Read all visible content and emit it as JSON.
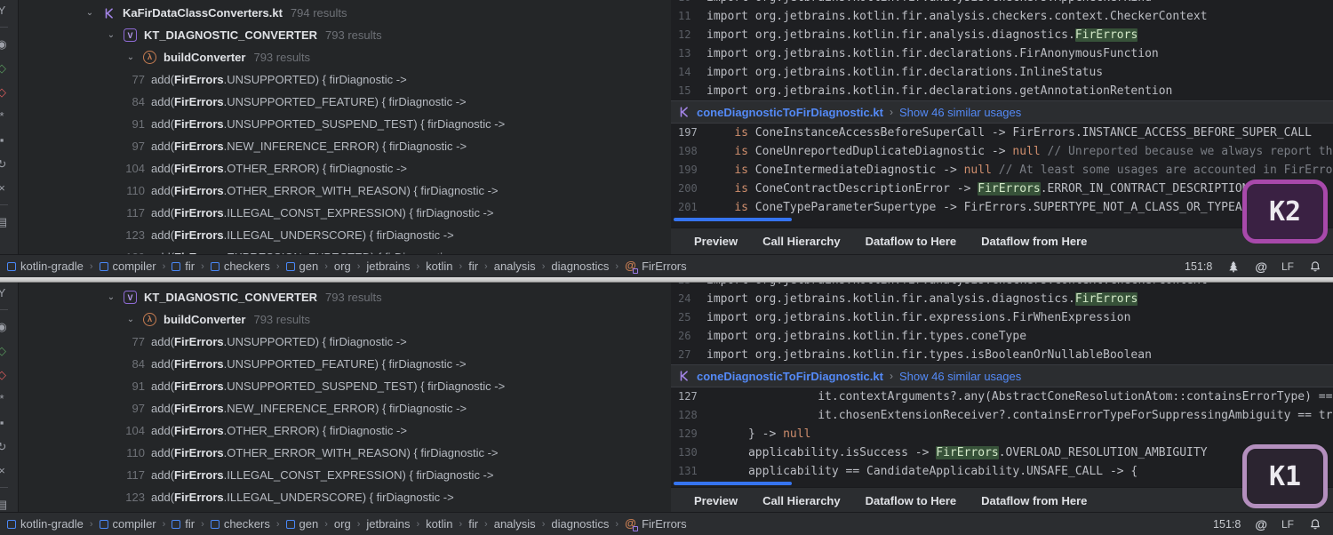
{
  "shared": {
    "tabs": [
      "Preview",
      "Call Hierarchy",
      "Dataflow to Here",
      "Dataflow from Here"
    ],
    "preview_file": "coneDiagnosticToFirDiagnostic.kt",
    "show_similar": "Show 46 similar usages",
    "caret_position": "151:8",
    "line_ending": "LF",
    "breadcrumbs": [
      {
        "label": "kotlin-gradle",
        "icon": "module"
      },
      {
        "label": "compiler",
        "icon": "module"
      },
      {
        "label": "fir",
        "icon": "module"
      },
      {
        "label": "checkers",
        "icon": "module"
      },
      {
        "label": "gen",
        "icon": "module"
      },
      {
        "label": "org"
      },
      {
        "label": "jetbrains"
      },
      {
        "label": "kotlin"
      },
      {
        "label": "fir"
      },
      {
        "label": "analysis"
      },
      {
        "label": "diagnostics"
      },
      {
        "label": "FirErrors",
        "icon": "kotlin-object"
      }
    ],
    "tree": {
      "file_name": "KaFirDataClassConverters.kt",
      "file_count": "794 results",
      "field_name": "KT_DIAGNOSTIC_CONVERTER",
      "field_count": "793 results",
      "function_name": "buildConverter",
      "function_count": "793 results",
      "val_icon_glyph": "V",
      "function_icon_glyph": "λ"
    },
    "usages": [
      {
        "line": "77",
        "call": "add(",
        "match": "FirErrors",
        "rest": ".UNSUPPORTED) { firDiagnostic ->"
      },
      {
        "line": "84",
        "call": "add(",
        "match": "FirErrors",
        "rest": ".UNSUPPORTED_FEATURE) { firDiagnostic ->"
      },
      {
        "line": "91",
        "call": "add(",
        "match": "FirErrors",
        "rest": ".UNSUPPORTED_SUSPEND_TEST) { firDiagnostic ->"
      },
      {
        "line": "97",
        "call": "add(",
        "match": "FirErrors",
        "rest": ".NEW_INFERENCE_ERROR) { firDiagnostic ->"
      },
      {
        "line": "104",
        "call": "add(",
        "match": "FirErrors",
        "rest": ".OTHER_ERROR) { firDiagnostic ->"
      },
      {
        "line": "110",
        "call": "add(",
        "match": "FirErrors",
        "rest": ".OTHER_ERROR_WITH_REASON) { firDiagnostic ->"
      },
      {
        "line": "117",
        "call": "add(",
        "match": "FirErrors",
        "rest": ".ILLEGAL_CONST_EXPRESSION) { firDiagnostic ->"
      },
      {
        "line": "123",
        "call": "add(",
        "match": "FirErrors",
        "rest": ".ILLEGAL_UNDERSCORE) { firDiagnostic ->"
      },
      {
        "line": "129",
        "call": "add(",
        "match": "FirErrors",
        "rest": ".EXPRESSION_EXPECTED) { firDiagnostic ->"
      }
    ],
    "stripe_icons": [
      {
        "name": "branch-icon",
        "glyph": "Y"
      },
      {
        "name": "divider"
      },
      {
        "name": "preview-usages-icon",
        "glyph": "◉"
      },
      {
        "name": "show-read-access-icon",
        "glyph": "◇",
        "color": "#57965c"
      },
      {
        "name": "show-write-access-icon",
        "glyph": "◇",
        "color": "#db5c5c"
      },
      {
        "name": "settings-icon",
        "glyph": "*"
      },
      {
        "name": "pin-icon",
        "glyph": "▪"
      },
      {
        "name": "rerun-icon",
        "glyph": "↻"
      },
      {
        "name": "close-icon",
        "glyph": "×"
      },
      {
        "name": "divider"
      },
      {
        "name": "open-in-editor-icon",
        "glyph": "▤"
      }
    ],
    "colors": {
      "accent_blue": "#3574f0",
      "link_blue": "#548af7",
      "match_highlight_bg": "#375239",
      "keyword_orange": "#cf8e6d",
      "kotlin_purple": "#a485e8",
      "module_blue": "#4a88f7",
      "badge_k2_border": "#a849ab",
      "badge_k1_border": "#b48fbe"
    }
  },
  "k2": {
    "badge": "K2",
    "show_file_row": true,
    "status_tree_icon": true,
    "imports": [
      {
        "num": "10",
        "segs": [
          [
            "p",
            "import org.jetbrains.kotlin.fir.analysis.checkers.MppCheckerKind"
          ]
        ]
      },
      {
        "num": "11",
        "segs": [
          [
            "p",
            "import org.jetbrains.kotlin.fir.analysis.checkers.context.CheckerContext"
          ]
        ]
      },
      {
        "num": "12",
        "segs": [
          [
            "p",
            "import org.jetbrains.kotlin.fir.analysis.diagnostics."
          ],
          [
            "h",
            "FirErrors"
          ]
        ]
      },
      {
        "num": "13",
        "segs": [
          [
            "p",
            "import org.jetbrains.kotlin.fir.declarations.FirAnonymousFunction"
          ]
        ]
      },
      {
        "num": "14",
        "segs": [
          [
            "p",
            "import org.jetbrains.kotlin.fir.declarations.InlineStatus"
          ]
        ]
      },
      {
        "num": "15",
        "segs": [
          [
            "p",
            "import org.jetbrains.kotlin.fir.declarations.getAnnotationRetention"
          ]
        ]
      }
    ],
    "snippet": [
      {
        "num": "197",
        "current": true,
        "segs": [
          [
            "p",
            "    "
          ],
          [
            "k",
            "is"
          ],
          [
            "p",
            " ConeInstanceAccessBeforeSuperCall -> FirErrors.INSTANCE_ACCESS_BEFORE_SUPER_CALL"
          ]
        ]
      },
      {
        "num": "198",
        "segs": [
          [
            "p",
            "    "
          ],
          [
            "k",
            "is"
          ],
          [
            "p",
            " ConeUnreportedDuplicateDiagnostic -> "
          ],
          [
            "k",
            "null"
          ],
          [
            "p",
            " "
          ],
          [
            "c",
            "// Unreported because we always report the diagnostic"
          ]
        ]
      },
      {
        "num": "199",
        "segs": [
          [
            "p",
            "    "
          ],
          [
            "k",
            "is"
          ],
          [
            "p",
            " ConeIntermediateDiagnostic -> "
          ],
          [
            "k",
            "null"
          ],
          [
            "p",
            " "
          ],
          [
            "c",
            "// At least some usages are accounted in FirErrors"
          ]
        ]
      },
      {
        "num": "200",
        "segs": [
          [
            "p",
            "    "
          ],
          [
            "k",
            "is"
          ],
          [
            "p",
            " ConeContractDescriptionError -> "
          ],
          [
            "h",
            "FirErrors"
          ],
          [
            "p",
            ".ERROR_IN_CONTRACT_DESCRIPTION"
          ]
        ]
      },
      {
        "num": "201",
        "segs": [
          [
            "p",
            "    "
          ],
          [
            "k",
            "is"
          ],
          [
            "p",
            " ConeTypeParameterSupertype -> FirErrors.SUPERTYPE_NOT_A_CLASS_OR_TYPEALIAS"
          ]
        ]
      }
    ]
  },
  "k1": {
    "badge": "K1",
    "show_file_row": false,
    "status_tree_icon": false,
    "imports": [
      {
        "num": "23",
        "segs": [
          [
            "p",
            "import org.jetbrains.kotlin.fir.analysis.checkers.context.CheckerContext"
          ]
        ]
      },
      {
        "num": "24",
        "segs": [
          [
            "p",
            "import org.jetbrains.kotlin.fir.analysis.diagnostics."
          ],
          [
            "h",
            "FirErrors"
          ]
        ]
      },
      {
        "num": "25",
        "segs": [
          [
            "p",
            "import org.jetbrains.kotlin.fir.expressions.FirWhenExpression"
          ]
        ]
      },
      {
        "num": "26",
        "segs": [
          [
            "p",
            "import org.jetbrains.kotlin.fir.types.coneType"
          ]
        ]
      },
      {
        "num": "27",
        "segs": [
          [
            "p",
            "import org.jetbrains.kotlin.fir.types.isBooleanOrNullableBoolean"
          ]
        ]
      }
    ],
    "snippet": [
      {
        "num": "127",
        "current": true,
        "segs": [
          [
            "p",
            "                it.contextArguments?.any(AbstractConeResolutionAtom::containsErrorType) == true ||"
          ]
        ]
      },
      {
        "num": "128",
        "segs": [
          [
            "p",
            "                it.chosenExtensionReceiver?.containsErrorTypeForSuppressingAmbiguity == true"
          ]
        ]
      },
      {
        "num": "129",
        "segs": [
          [
            "p",
            "      } -> "
          ],
          [
            "k",
            "null"
          ]
        ]
      },
      {
        "num": "130",
        "segs": [
          [
            "p",
            "      applicability.isSuccess -> "
          ],
          [
            "h",
            "FirErrors"
          ],
          [
            "p",
            ".OVERLOAD_RESOLUTION_AMBIGUITY"
          ]
        ]
      },
      {
        "num": "131",
        "segs": [
          [
            "p",
            "      applicability == CandidateApplicability.UNSAFE_CALL -> {"
          ]
        ]
      }
    ]
  }
}
